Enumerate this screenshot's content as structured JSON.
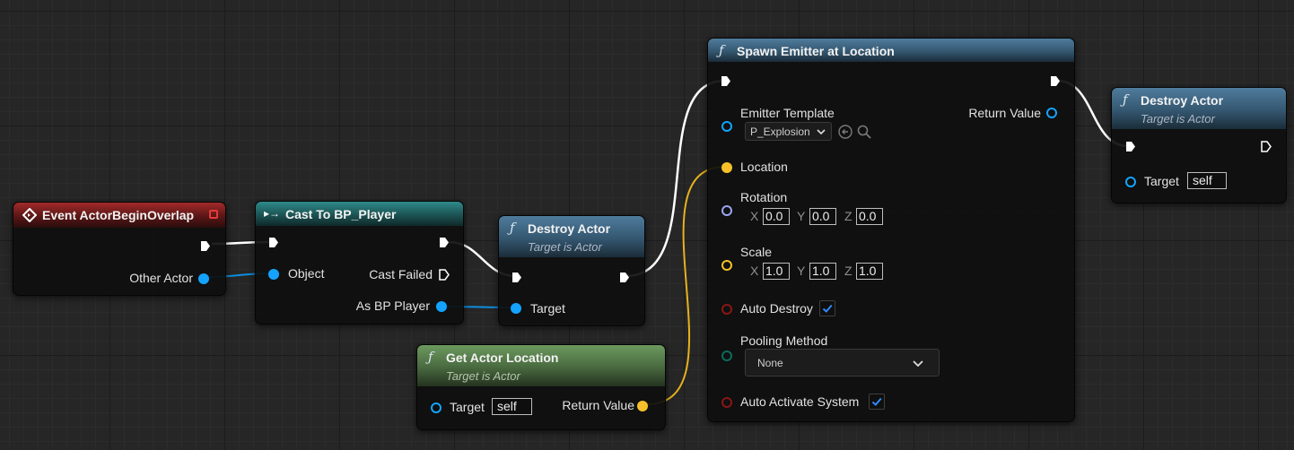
{
  "graph": {
    "nodes": {
      "event_begin_overlap": {
        "title": "Event ActorBeginOverlap",
        "pin_other_actor": "Other Actor"
      },
      "cast_to_player": {
        "title": "Cast To BP_Player",
        "pin_object": "Object",
        "pin_cast_failed": "Cast Failed",
        "pin_as_player": "As BP Player"
      },
      "destroy_actor_1": {
        "title": "Destroy Actor",
        "subtitle": "Target is Actor",
        "pin_target": "Target"
      },
      "get_actor_location": {
        "title": "Get Actor Location",
        "subtitle": "Target is Actor",
        "pin_target": "Target",
        "target_value": "self",
        "pin_return": "Return Value"
      },
      "spawn_emitter": {
        "title": "Spawn Emitter at Location",
        "pin_emitter_template": "Emitter Template",
        "emitter_template_value": "P_Explosion",
        "pin_return": "Return Value",
        "pin_location": "Location",
        "pin_rotation": "Rotation",
        "rotation": {
          "x": "0.0",
          "y": "0.0",
          "z": "0.0"
        },
        "pin_scale": "Scale",
        "scale": {
          "x": "1.0",
          "y": "1.0",
          "z": "1.0"
        },
        "pin_auto_destroy": "Auto Destroy",
        "auto_destroy_checked": true,
        "pin_pooling_method": "Pooling Method",
        "pooling_method_value": "None",
        "pin_auto_activate": "Auto Activate System",
        "auto_activate_checked": true
      },
      "destroy_actor_2": {
        "title": "Destroy Actor",
        "subtitle": "Target is Actor",
        "pin_target": "Target",
        "target_value": "self"
      }
    },
    "axis_labels": {
      "x": "X",
      "y": "Y",
      "z": "Z"
    },
    "colors": {
      "exec": "#ffffff",
      "object_pin": "#14a3ff",
      "vector_pin": "#f5c02a",
      "rotator_pin": "#9aa6f2",
      "bool_pin": "#8a1616",
      "enum_pin": "#0f6a5e",
      "checkbox_accent": "#2f8cff"
    },
    "icons": {
      "function": "function-f-icon",
      "event": "event-diamond-icon",
      "cast": "cast-arrows-icon",
      "browse": "browse-arrow-icon",
      "search": "search-icon"
    }
  }
}
